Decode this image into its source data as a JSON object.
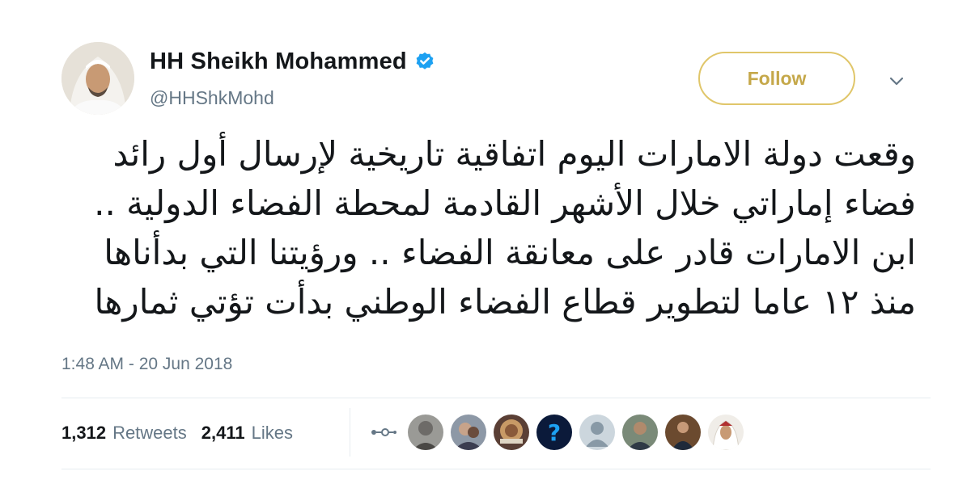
{
  "header": {
    "display_name": "HH Sheikh Mohammed",
    "handle": "@HHShkMohd",
    "follow_label": "Follow",
    "verified_icon": "verified-badge-icon",
    "menu_icon": "chevron-down-icon"
  },
  "tweet": {
    "lines": [
      "وقعت دولة الامارات اليوم اتفاقية تاريخية لإرسال أول رائد",
      "فضاء إماراتي خلال الأشهر القادمة لمحطة الفضاء الدولية ..",
      "ابن الامارات قادر على معانقة الفضاء .. ورؤيتنا التي بدأناها",
      "منذ ١٢ عاما لتطوير قطاع الفضاء الوطني بدأت تؤتي ثمارها"
    ],
    "timestamp": "1:48 AM - 20 Jun 2018"
  },
  "stats": {
    "retweets_count": "1,312",
    "retweets_label": "Retweets",
    "likes_count": "2,411",
    "likes_label": "Likes"
  },
  "likers": [
    "liker-1",
    "liker-2",
    "liker-3",
    "liker-4",
    "liker-5",
    "liker-6",
    "liker-7",
    "liker-8"
  ],
  "colors": {
    "follow_border": "#e0c66a",
    "follow_text": "#c5a84a",
    "verified_blue": "#1da1f2",
    "secondary_text": "#657786"
  }
}
